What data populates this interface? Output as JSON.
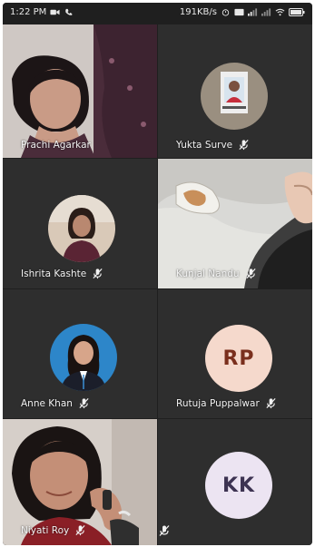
{
  "status_bar": {
    "time": "1:22 PM",
    "network_speed": "191KB/s"
  },
  "participants": [
    {
      "name": "Prachi Agarkar",
      "muted": false,
      "video": "camera"
    },
    {
      "name": "Yukta Surve",
      "muted": true,
      "video": "photo-avatar"
    },
    {
      "name": "Ishrita Kashte",
      "muted": true,
      "video": "photo-avatar"
    },
    {
      "name": "Kunjal Nandu",
      "muted": true,
      "video": "camera"
    },
    {
      "name": "Anne Khan",
      "muted": true,
      "video": "photo-avatar"
    },
    {
      "name": "Rutuja Puppalwar",
      "muted": true,
      "video": "initials",
      "initials": "RP"
    },
    {
      "name": "Niyati Roy",
      "muted": true,
      "video": "camera"
    },
    {
      "name": "",
      "muted": false,
      "video": "initials",
      "initials": "KK"
    }
  ],
  "colors": {
    "tile_bg": "#2e2e2e",
    "screen_bg": "#1f1f1f",
    "rp_avatar_bg": "#f5d9cc",
    "rp_avatar_text": "#7a2f1d",
    "kk_avatar_bg": "#ece4f2",
    "kk_avatar_text": "#3d3352"
  },
  "icons": {
    "mic_off": "mic-off-icon",
    "call": "phone-icon",
    "wifi": "wifi-icon",
    "battery": "battery-icon"
  }
}
